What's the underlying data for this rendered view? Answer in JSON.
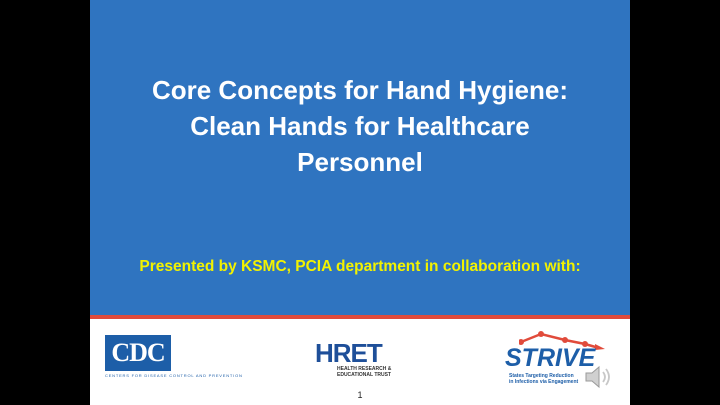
{
  "slide": {
    "title_lines": [
      "Core Concepts for Hand Hygiene:",
      "Clean Hands for Healthcare",
      "Personnel"
    ],
    "subtitle": "Presented by KSMC, PCIA department in collaboration with:",
    "page_number": "1"
  },
  "logos": {
    "cdc": {
      "letters": "CDC",
      "caption": "CENTERS FOR DISEASE CONTROL AND PREVENTION"
    },
    "hret": {
      "letters": "HRET",
      "caption_line1": "HEALTH RESEARCH &",
      "caption_line2": "EDUCATIONAL TRUST"
    },
    "strive": {
      "letters": "STRIVE",
      "caption_line1": "States Targeting Reduction",
      "caption_line2": "in Infections via Engagement"
    }
  },
  "icons": {
    "audio": "speaker-icon"
  },
  "colors": {
    "background": "#000000",
    "slide_blue": "#2f74c0",
    "title_text": "#ffffff",
    "subtitle_text": "#f2f200",
    "stripe_red": "#e14b3b",
    "logo_blue": "#1d5ea8"
  }
}
